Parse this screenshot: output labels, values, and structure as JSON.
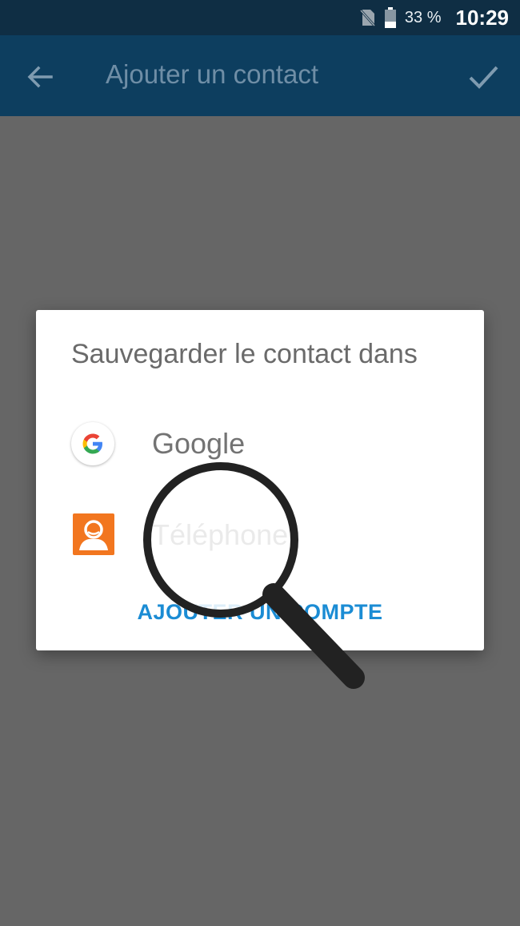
{
  "status_bar": {
    "battery_percent": "33 %",
    "time": "10:29",
    "icons": [
      "no-sim-icon",
      "battery-icon"
    ]
  },
  "app_bar": {
    "title": "Ajouter un contact",
    "back_icon": "arrow-back-icon",
    "confirm_icon": "check-icon"
  },
  "dialog": {
    "title": "Sauvegarder le contact dans",
    "options": [
      {
        "label": "Google",
        "icon": "google-icon"
      },
      {
        "label": "Téléphone",
        "icon": "phone-contact-icon"
      }
    ],
    "add_account_label": "AJOUTER UN COMPTE"
  },
  "colors": {
    "app_bar": "#0d3e5f",
    "status_bar": "#0f2e44",
    "scrim": "#666666",
    "accent": "#1b8cd4",
    "phone_icon": "#f2761f"
  }
}
